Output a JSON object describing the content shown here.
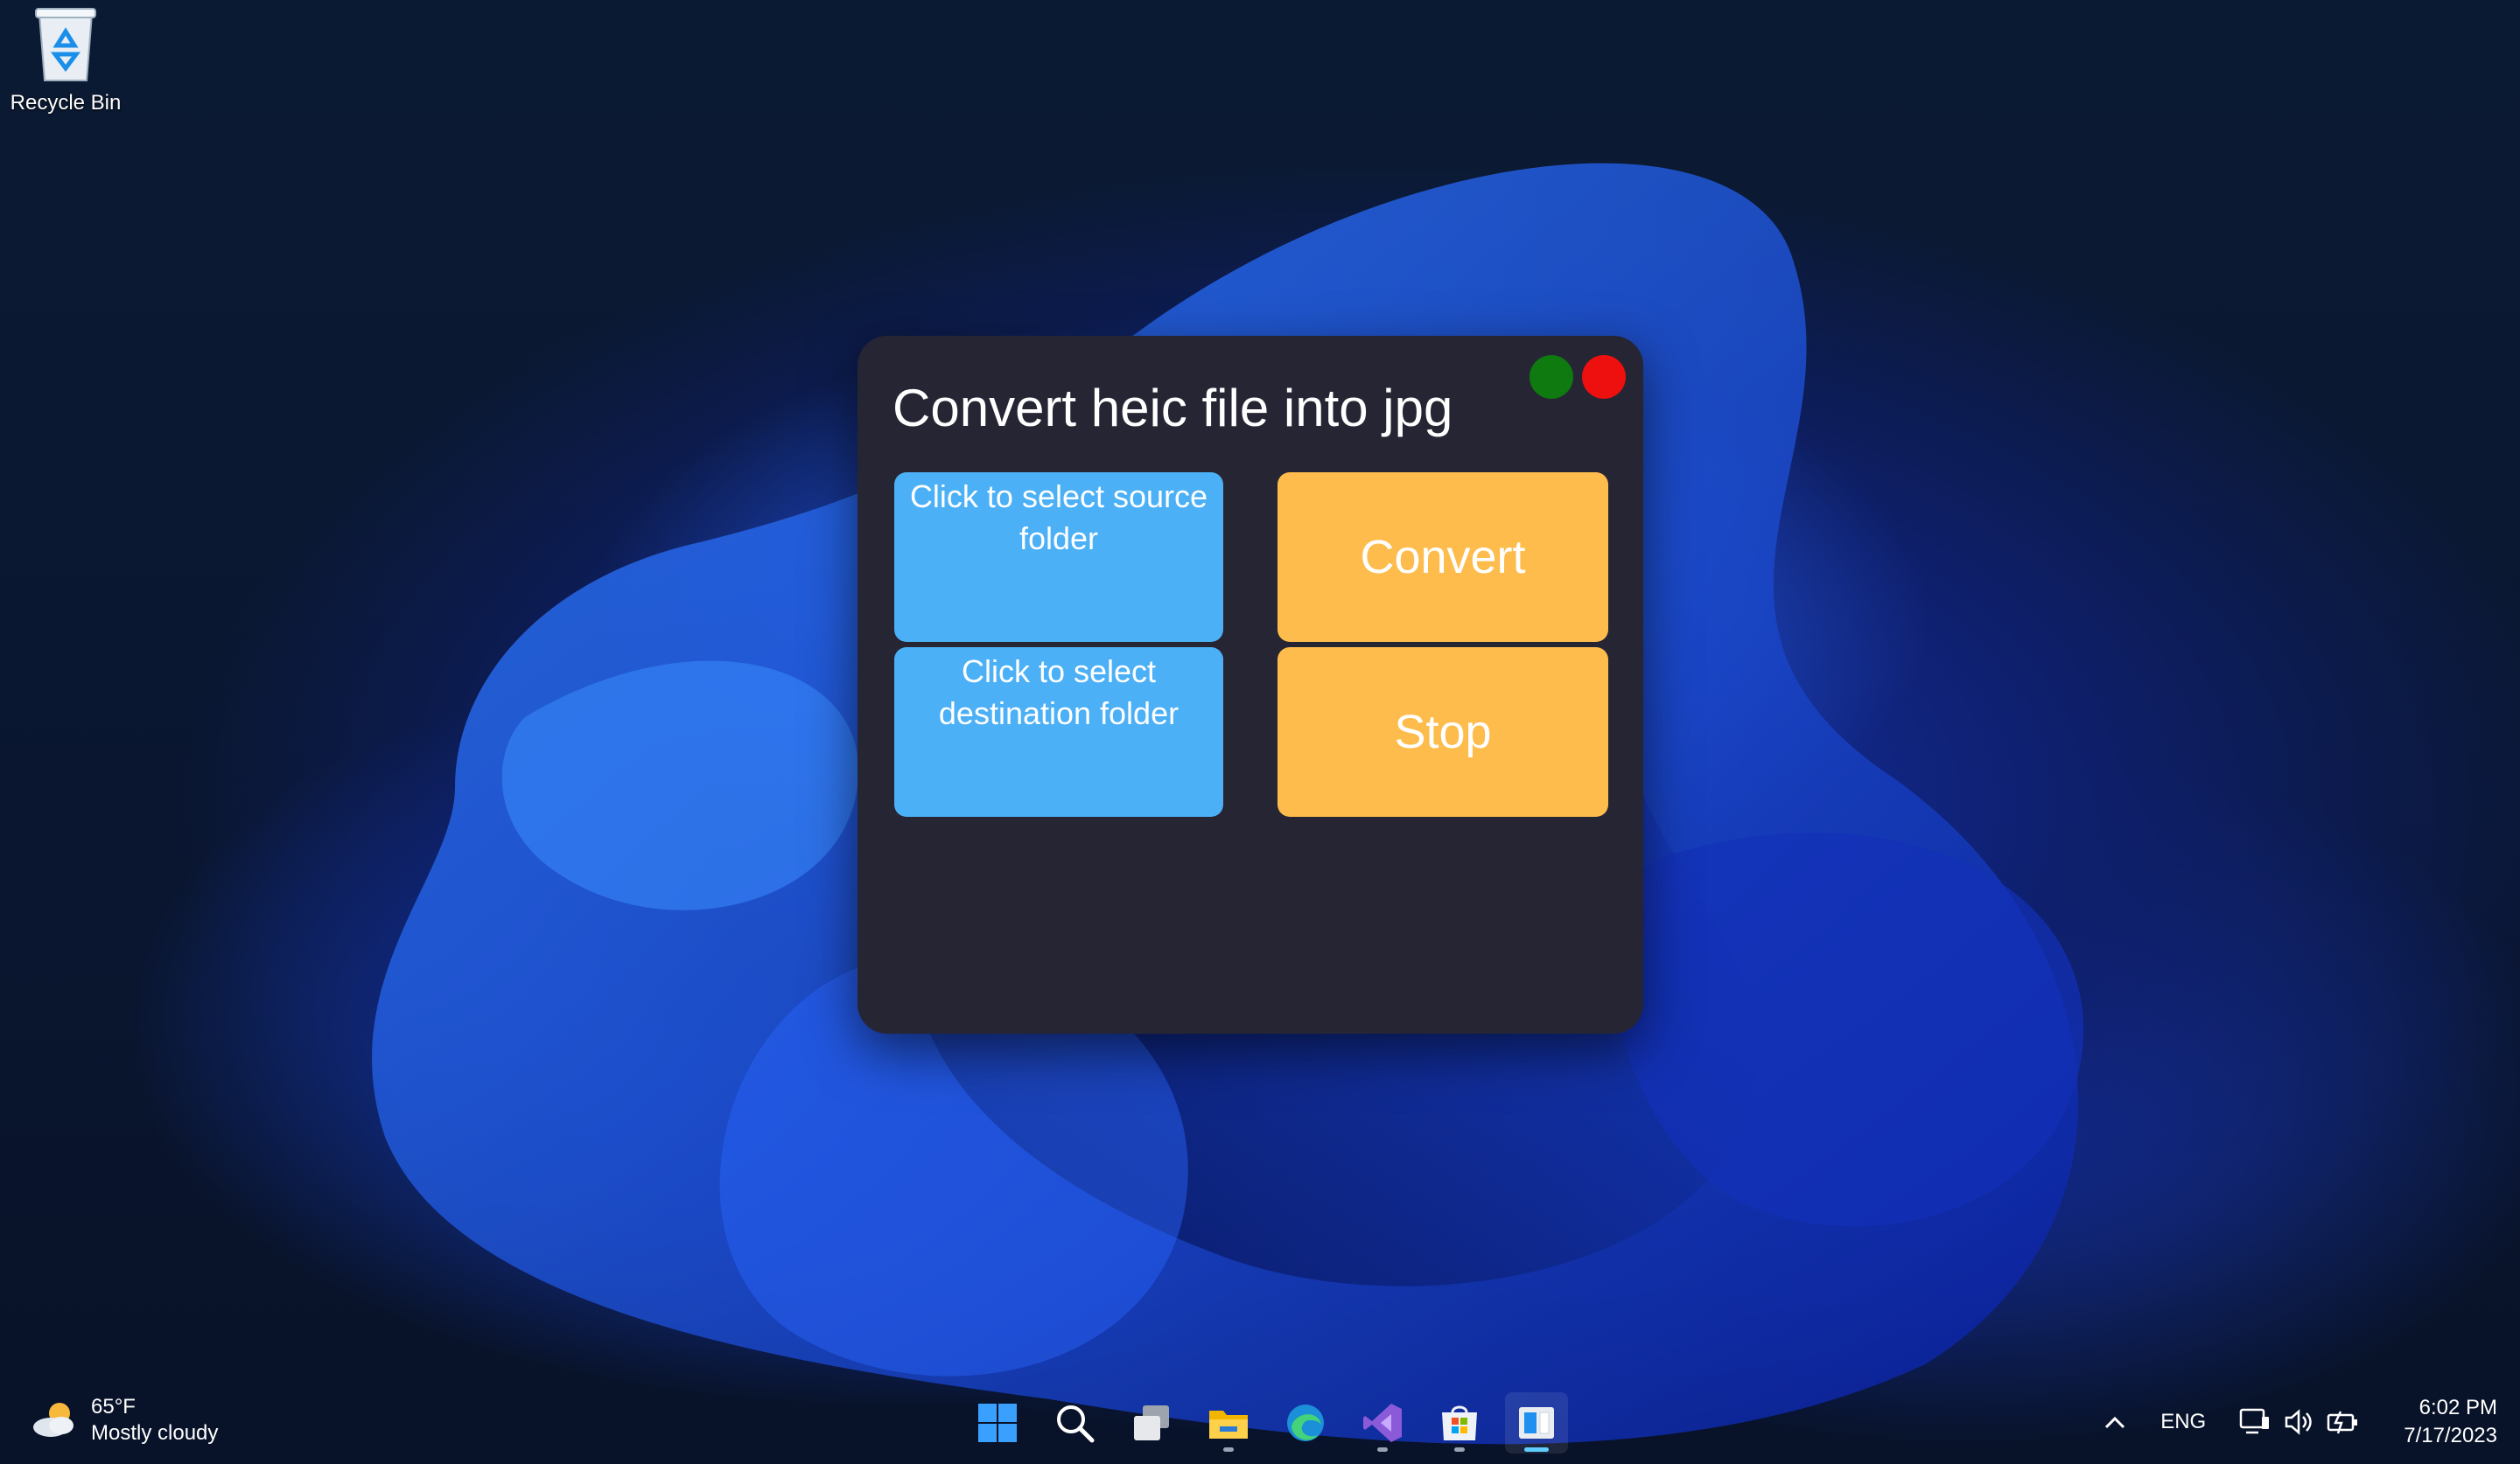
{
  "desktop": {
    "recycle_bin_label": "Recycle Bin"
  },
  "window": {
    "title": "Convert heic file into jpg",
    "buttons": {
      "source_line1": "Click to select source",
      "source_line2": "folder",
      "destination_line1": "Click to select",
      "destination_line2": "destination folder",
      "convert": "Convert",
      "stop": "Stop"
    },
    "colors": {
      "background": "#262534",
      "blue_button": "#4cb0f6",
      "orange_button": "#fdbc4b",
      "green_dot": "#0f7a0f",
      "red_dot": "#ee0f0f"
    }
  },
  "taskbar": {
    "weather_temp": "65°F",
    "weather_desc": "Mostly cloudy",
    "language": "ENG",
    "time": "6:02 PM",
    "date": "7/17/2023",
    "pinned_icons": [
      "windows-start-icon",
      "search-icon",
      "task-view-icon",
      "file-explorer-icon",
      "edge-icon",
      "visual-studio-icon",
      "microsoft-store-icon",
      "app-window-icon"
    ]
  }
}
